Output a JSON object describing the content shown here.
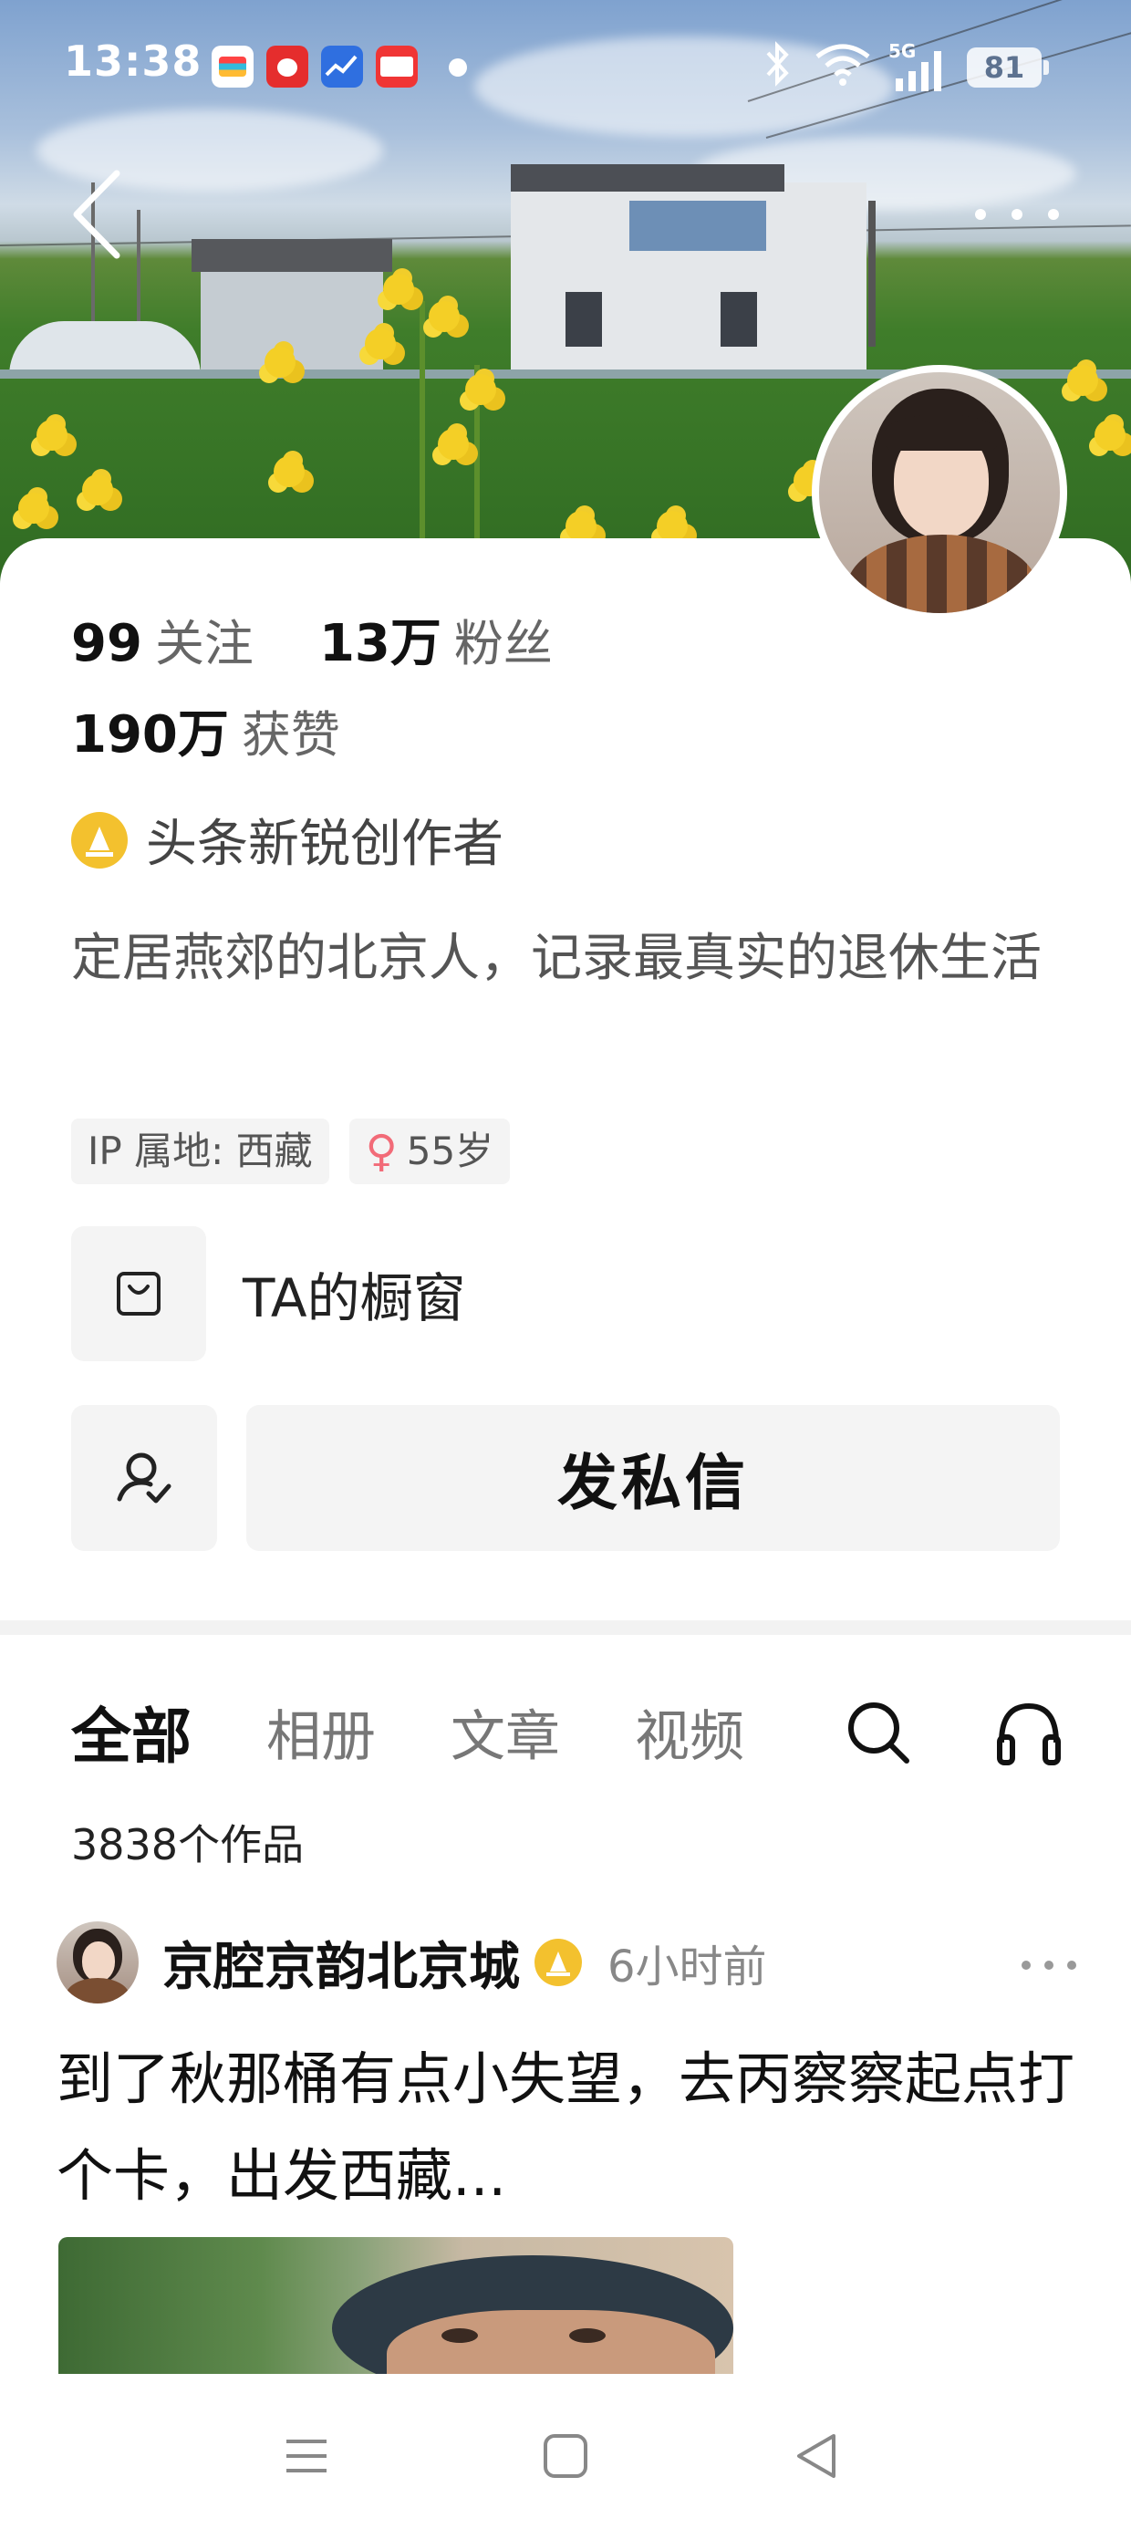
{
  "status_bar": {
    "time": "13:38",
    "battery": "81",
    "network": "5G"
  },
  "profile": {
    "stats": [
      {
        "value": "99",
        "label": "关注"
      },
      {
        "value": "13万",
        "label": "粉丝"
      },
      {
        "value": "190万",
        "label": "获赞"
      }
    ],
    "badge": "头条新锐创作者",
    "bio": "定居燕郊的北京人，记录最真实的退休生活",
    "ip_tag": "IP 属地: 西藏",
    "gender_icon": "♀",
    "age_tag": "55岁",
    "shop_label": "TA的橱窗",
    "message_button": "发私信"
  },
  "tabs": {
    "items": [
      "全部",
      "相册",
      "文章",
      "视频"
    ],
    "active": "全部",
    "works_count": "3838个作品"
  },
  "post": {
    "author": "京腔京韵北京城",
    "time": "6小时前",
    "text": "到了秋那桶有点小失望，去丙察察起点打个卡，出发西藏..."
  },
  "colors": {
    "badge_gold": "#f3c12e",
    "female_pink": "#f26b78"
  }
}
